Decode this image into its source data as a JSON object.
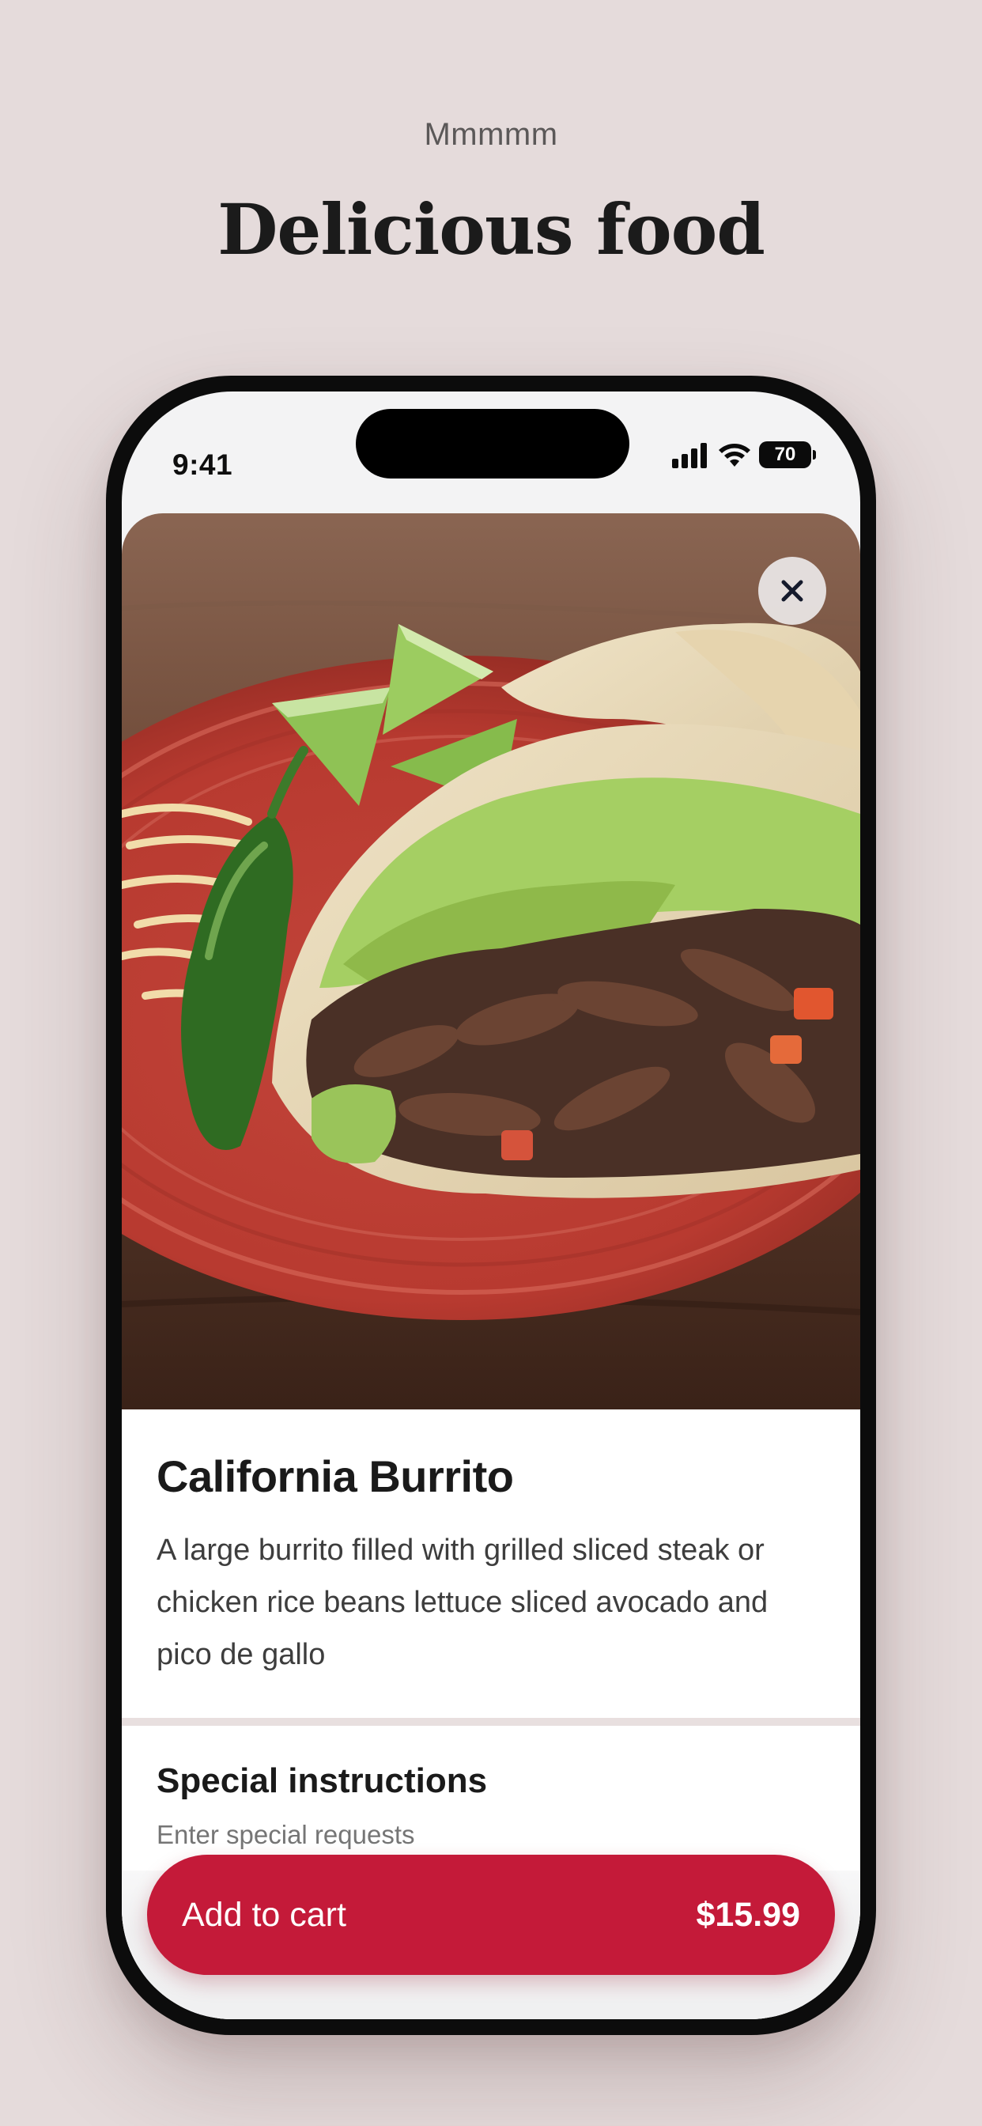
{
  "header": {
    "eyebrow": "Mmmmm",
    "title": "Delicious food"
  },
  "status_bar": {
    "time": "9:41",
    "battery": "70",
    "icons": [
      "signal-icon",
      "wifi-icon",
      "battery-icon"
    ]
  },
  "product": {
    "image_icon": "food-photo",
    "name": "California Burrito",
    "description": "A large burrito filled with grilled sliced steak or chicken rice beans lettuce sliced avocado and pico de gallo"
  },
  "instructions": {
    "title": "Special instructions",
    "placeholder": "Enter special requests"
  },
  "cart": {
    "label": "Add to cart",
    "price": "$15.99"
  },
  "colors": {
    "background": "#e5dbdb",
    "accent": "#c41a39"
  }
}
